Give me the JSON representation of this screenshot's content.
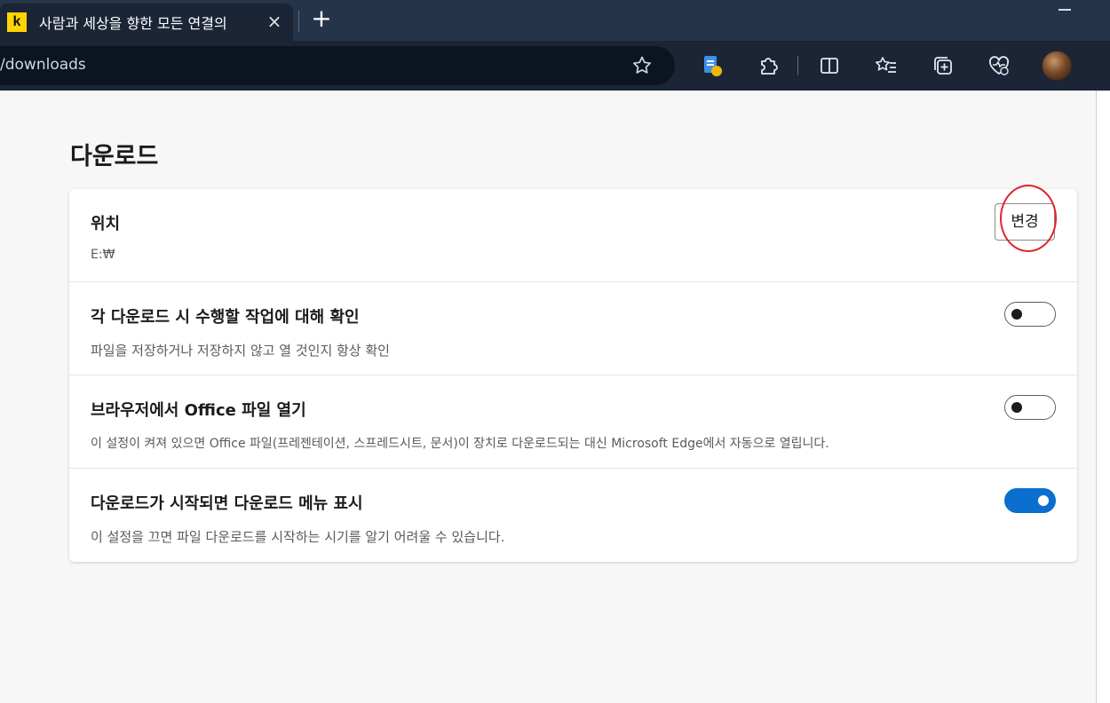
{
  "browser": {
    "tab": {
      "favicon_letter": "k",
      "title": "사람과 세상을 향한 모든 연결의",
      "close_symbol": "×"
    },
    "new_tab_symbol": "+",
    "address": {
      "url": "/downloads"
    },
    "toolbar_icons": [
      "favorite-star-icon",
      "shield-doc-icon",
      "extensions-icon",
      "split-screen-icon",
      "favorites-list-icon",
      "collections-icon",
      "browser-essentials-icon",
      "profile-avatar"
    ]
  },
  "page": {
    "title": "다운로드",
    "settings": [
      {
        "label": "위치",
        "description": "E:₩",
        "button_label": "변경"
      },
      {
        "label": "각 다운로드 시 수행할 작업에 대해 확인",
        "description": "파일을 저장하거나 저장하지 않고 열 것인지 항상 확인",
        "toggle_on": false
      },
      {
        "label": "브라우저에서 Office 파일 열기",
        "description": "이 설정이 켜져 있으면 Office 파일(프레젠테이션, 스프레드시트, 문서)이 장치로 다운로드되는 대신 Microsoft Edge에서 자동으로 열립니다.",
        "toggle_on": false
      },
      {
        "label": "다운로드가 시작되면 다운로드 메뉴 표시",
        "description": "이 설정을 끄면 파일 다운로드를 시작하는 시기를 알기 어려울 수 있습니다.",
        "toggle_on": true
      }
    ]
  },
  "colors": {
    "toggle_on": "#0b6fcf",
    "annotation_circle": "#e0242e",
    "titlebar": "#253449"
  }
}
